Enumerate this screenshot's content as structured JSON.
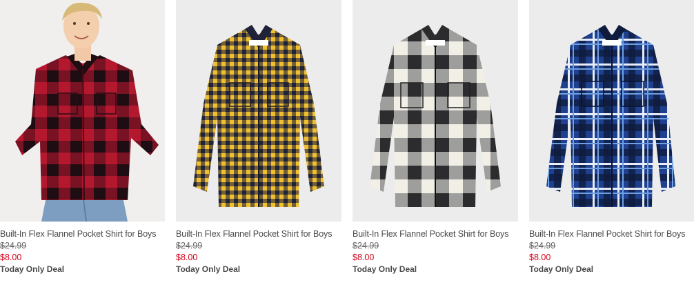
{
  "products": [
    {
      "name": "Built-In Flex Flannel Pocket Shirt for Boys",
      "was_price": "$24.99",
      "sale_price": "$8.00",
      "promo": "Today Only Deal",
      "image": "red-black-buffalo-check-shirt-on-model",
      "colors": {
        "base": "#b4182f",
        "dark": "#1e0d12",
        "bg": "#f0efee"
      }
    },
    {
      "name": "Built-In Flex Flannel Pocket Shirt for Boys",
      "was_price": "$24.99",
      "sale_price": "$8.00",
      "promo": "Today Only Deal",
      "image": "yellow-navy-gingham-shirt",
      "colors": {
        "base": "#f0c030",
        "dark": "#1f2238",
        "bg": "#ececec"
      }
    },
    {
      "name": "Built-In Flex Flannel Pocket Shirt for Boys",
      "was_price": "$24.99",
      "sale_price": "$8.00",
      "promo": "Today Only Deal",
      "image": "black-white-buffalo-check-shirt",
      "colors": {
        "base": "#f2efe6",
        "dark": "#2c2c2e",
        "bg": "#ececec"
      }
    },
    {
      "name": "Built-In Flex Flannel Pocket Shirt for Boys",
      "was_price": "$24.99",
      "sale_price": "$8.00",
      "promo": "Today Only Deal",
      "image": "blue-white-plaid-shirt",
      "colors": {
        "base": "#1f3f8f",
        "dark": "#0f1b3d",
        "bg": "#ececec"
      }
    }
  ]
}
